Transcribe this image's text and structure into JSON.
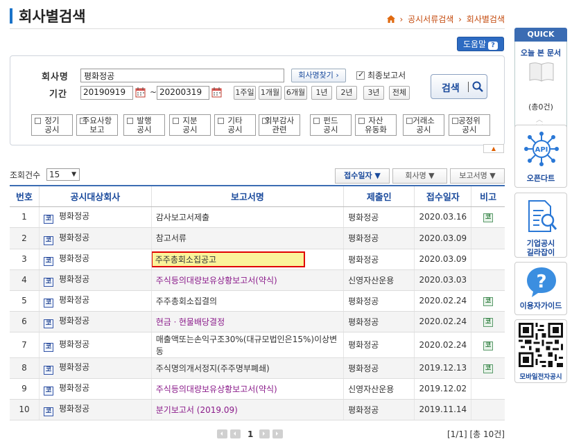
{
  "header": {
    "title": "회사별검색",
    "breadcrumb": [
      "공시서류검색",
      "회사별검색"
    ]
  },
  "help_label": "도움말",
  "form": {
    "company_label": "회사명",
    "company_value": "평화정공",
    "find_company_label": "회사명찾기 ›",
    "final_report_label": "최종보고서",
    "final_report_checked": true,
    "period_label": "기간",
    "start_date": "20190919",
    "end_date": "20200319",
    "date_sep": "~",
    "ranges": [
      "1주일",
      "1개월",
      "6개월",
      "1년",
      "2년",
      "3년",
      "전체"
    ],
    "search_label": "검색",
    "categories": [
      [
        "정기",
        "공시"
      ],
      [
        "주요사항",
        "보고"
      ],
      [
        "발행",
        "공시"
      ],
      [
        "지분",
        "공시"
      ],
      [
        "기타",
        "공시"
      ],
      [
        "외부감사",
        "관련"
      ],
      [
        "펀드",
        "공시"
      ],
      [
        "자산",
        "유동화"
      ],
      [
        "거래소",
        "공시"
      ],
      [
        "공정위",
        "공시"
      ]
    ]
  },
  "list": {
    "count_label": "조회건수",
    "count_value": "15",
    "sort_buttons": [
      "접수일자 ▼",
      "회사명 ▼",
      "보고서명 ▼"
    ],
    "columns": [
      "번호",
      "공시대상회사",
      "보고서명",
      "제출인",
      "접수일자",
      "비고"
    ],
    "corp_badge": "코",
    "note_badge": "코",
    "rows": [
      {
        "no": "1",
        "company": "평화정공",
        "report": "감사보고서제출",
        "submitter": "평화정공",
        "date": "2020.03.16",
        "note": true,
        "style": "plain"
      },
      {
        "no": "2",
        "company": "평화정공",
        "report": "참고서류",
        "submitter": "평화정공",
        "date": "2020.03.09",
        "note": false,
        "style": "plain"
      },
      {
        "no": "3",
        "company": "평화정공",
        "report": "주주총회소집공고",
        "submitter": "평화정공",
        "date": "2020.03.09",
        "note": false,
        "style": "highlight"
      },
      {
        "no": "4",
        "company": "평화정공",
        "report": "주식등의대량보유상황보고서(약식)",
        "submitter": "신영자산운용",
        "date": "2020.03.03",
        "note": false,
        "style": "purple"
      },
      {
        "no": "5",
        "company": "평화정공",
        "report": "주주총회소집결의",
        "submitter": "평화정공",
        "date": "2020.02.24",
        "note": true,
        "style": "plain"
      },
      {
        "no": "6",
        "company": "평화정공",
        "report": "현금ㆍ현물배당결정",
        "submitter": "평화정공",
        "date": "2020.02.24",
        "note": true,
        "style": "purple"
      },
      {
        "no": "7",
        "company": "평화정공",
        "report": "매출액또는손익구조30%(대규모법인은15%)이상변동",
        "submitter": "평화정공",
        "date": "2020.02.24",
        "note": true,
        "style": "plain"
      },
      {
        "no": "8",
        "company": "평화정공",
        "report": "주식명의개서정지(주주명부폐쇄)",
        "submitter": "평화정공",
        "date": "2019.12.13",
        "note": true,
        "style": "plain"
      },
      {
        "no": "9",
        "company": "평화정공",
        "report": "주식등의대량보유상황보고서(약식)",
        "submitter": "신영자산운용",
        "date": "2019.12.02",
        "note": false,
        "style": "purple"
      },
      {
        "no": "10",
        "company": "평화정공",
        "report": "분기보고서 (2019.09)",
        "submitter": "평화정공",
        "date": "2019.11.14",
        "note": false,
        "style": "purple"
      }
    ],
    "page": "1",
    "total": "[1/1] [총 10건]"
  },
  "quick": {
    "head": "QUICK",
    "recent_label": "오늘 본 문서",
    "recent_count": "(총0건)",
    "opendart_label": "오픈다트",
    "guide_label": [
      "기업공시",
      "길라잡이"
    ],
    "user_guide_label": "이용자가이드",
    "mobile_label": "모바일전자공시"
  },
  "colors": {
    "accent": "#3b6cb3",
    "purple_link": "#8a1a8a",
    "highlight_border": "#e00000",
    "highlight_fill": "#fbf39a"
  }
}
